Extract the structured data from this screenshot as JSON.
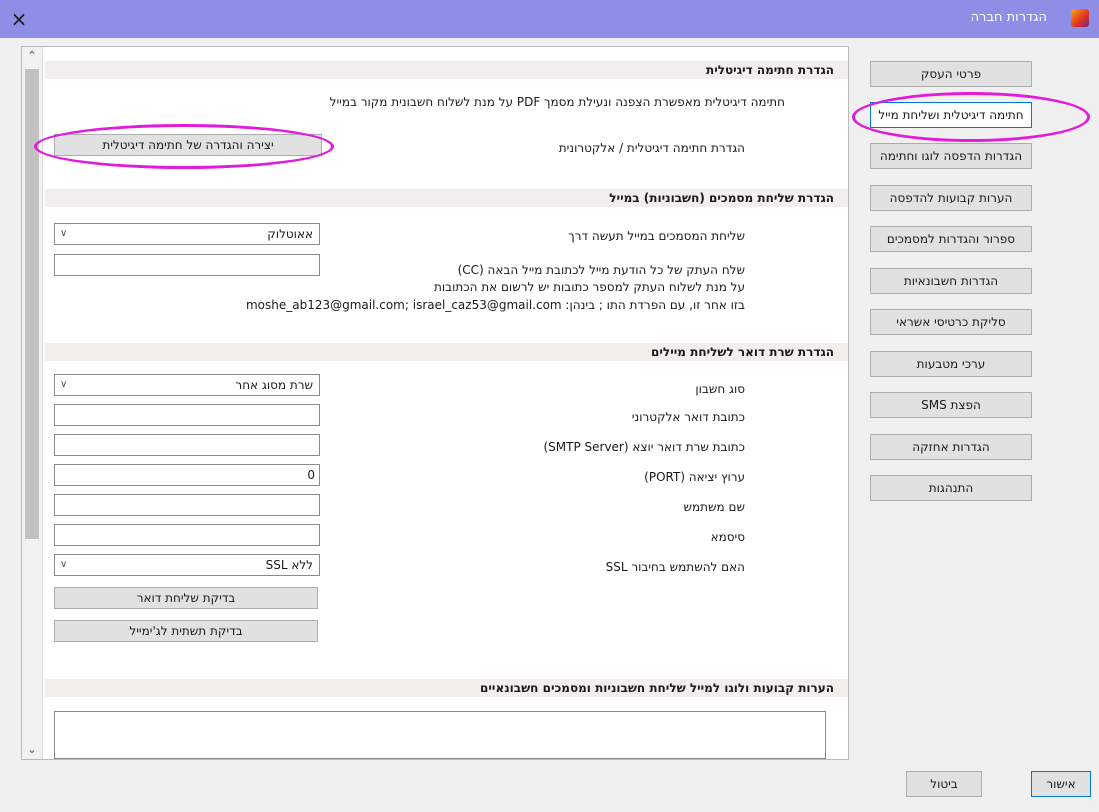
{
  "window": {
    "title": "הגדרות חברה",
    "close_glyph": "×",
    "accent_color": "#8e8ee6"
  },
  "nav": {
    "items": [
      {
        "label": "פרטי העסק"
      },
      {
        "label": "חתימה דיגיטלית ושליחת מייל"
      },
      {
        "label": "הגדרות הדפסה לוגו וחתימה"
      },
      {
        "label": "הערות קבועות להדפסה"
      },
      {
        "label": "ספרור והגדרות למסמכים"
      },
      {
        "label": "הגדרות חשבונאיות"
      },
      {
        "label": "סליקת כרטיסי אשראי"
      },
      {
        "label": "ערכי מטבעות"
      },
      {
        "label": "הפצת SMS"
      },
      {
        "label": "הגדרות אחזקה"
      },
      {
        "label": "התנהגות"
      }
    ],
    "selected": "חתימה דיגיטלית ושליחת מייל"
  },
  "digital_signature": {
    "header": "הגדרת חתימה דיגיטלית",
    "description": "חתימה דיגיטלית מאפשרת הצפנה ונעילת מסמך PDF על מנת לשלוח חשבונית  מקור במייל",
    "setup_label": "הגדרת חתימה דיגיטלית / אלקטרונית",
    "create_button": "יצירה והגדרה של חתימה דיגיטלית"
  },
  "email_sending": {
    "header": "הגדרת שליחת מסמכים (חשבוניות) במייל",
    "send_via_label": "שליחת המסמכים במייל תעשה דרך",
    "send_via_value": "אאוטלוק",
    "cc_line1": "שלח העתק של כל הודעת מייל לכתובת מייל הבאה (CC)",
    "cc_line2": "על מנת לשלוח העתק למספר כתובות יש לרשום את הכתובות",
    "cc_line3": "בזו אחר זו, עם הפרדת התו ; בינהן: moshe_ab123@gmail.com; israel_caz53@gmail.com",
    "cc_value": ""
  },
  "mail_server": {
    "header": "הגדרת שרת דואר לשליחת מיילים",
    "account_type_label": "סוג חשבון",
    "account_type_value": "שרת מסוג אחר",
    "email_label": "כתובת דואר אלקטרוני",
    "email_value": "",
    "smtp_label": "כתובת שרת דואר יוצא (SMTP Server)",
    "smtp_value": "",
    "port_label": "ערוץ יציאה (PORT)",
    "port_value": "0",
    "username_label": "שם משתמש",
    "username_value": "",
    "password_label": "סיסמא",
    "password_value": "",
    "ssl_label": "האם להשתמש בחיבור SSL",
    "ssl_value": "ללא SSL",
    "test_mail_button": "בדיקת שליחת דואר",
    "test_gmail_button": "בדיקת תשתית לג'ימייל"
  },
  "notes": {
    "header": "הערות קבועות ולוגו למייל שליחת חשבוניות ומסמכים חשבונאיים"
  },
  "footer": {
    "ok_button": "אישור",
    "cancel_button": "ביטול"
  },
  "annotation_color": "#e21adb"
}
